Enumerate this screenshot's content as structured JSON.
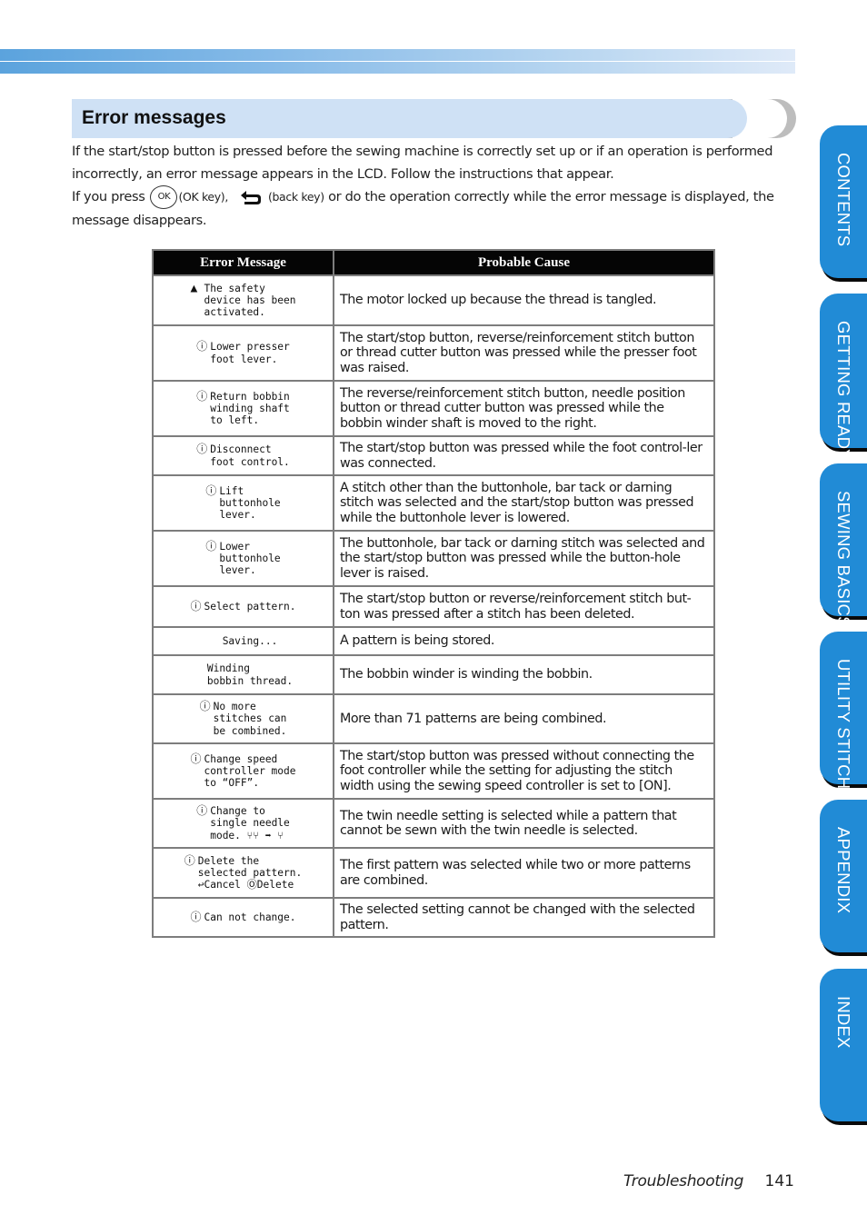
{
  "section": {
    "title": "Error messages"
  },
  "intro": {
    "line1": "If the start/stop button is pressed before the sewing machine is correctly set up or if an operation is performed incorrectly, an error message appears in the LCD. Follow the instructions that appear.",
    "line2_prefix": "If you press",
    "ok_key_glyph": "OK",
    "ok_key_label": "(OK key),",
    "back_key_label": "(back key)",
    "line2_suffix": "or do the operation correctly while the error message is displayed, the message disappears."
  },
  "table": {
    "headers": [
      "Error Message",
      "Probable Cause"
    ],
    "rows": [
      {
        "icon": "warning-icon",
        "glyph": "▲",
        "message": "The safety\ndevice has been\nactivated.",
        "cause": "The motor locked up because the thread is tangled."
      },
      {
        "icon": "alert-circle-icon",
        "glyph": "ⓘ",
        "message": "Lower presser\nfoot lever.",
        "cause": "The start/stop button, reverse/reinforcement stitch button or thread cutter button was pressed while the presser foot was raised."
      },
      {
        "icon": "alert-circle-icon",
        "glyph": "ⓘ",
        "message": "Return bobbin\nwinding shaft\nto left.",
        "cause": "The reverse/reinforcement stitch button, needle position button or thread cutter button was pressed while the bobbin winder shaft is moved to the right."
      },
      {
        "icon": "alert-circle-icon",
        "glyph": "ⓘ",
        "message": "Disconnect\nfoot control.",
        "cause": "The start/stop button was pressed while the foot control-ler was connected."
      },
      {
        "icon": "alert-circle-icon",
        "glyph": "ⓘ",
        "message": "Lift\nbuttonhole\nlever.",
        "cause": "A stitch other than the buttonhole, bar tack or darning stitch was selected and the start/stop button was pressed while the buttonhole lever is lowered."
      },
      {
        "icon": "alert-circle-icon",
        "glyph": "ⓘ",
        "message": "Lower\nbuttonhole\nlever.",
        "cause": "The buttonhole, bar tack or darning stitch was selected and the start/stop button was pressed while the button-hole lever is raised."
      },
      {
        "icon": "alert-circle-icon",
        "glyph": "ⓘ",
        "message": "Select pattern.",
        "cause": "The start/stop button or reverse/reinforcement stitch but-ton was pressed after a stitch has been deleted."
      },
      {
        "icon": "",
        "glyph": "",
        "message": "Saving...",
        "cause": "A pattern is being stored."
      },
      {
        "icon": "",
        "glyph": "",
        "message": "Winding\nbobbin thread.",
        "cause": "The bobbin winder is winding the bobbin."
      },
      {
        "icon": "alert-circle-icon",
        "glyph": "ⓘ",
        "message": "No more\nstitches can\nbe combined.",
        "cause": "More than 71 patterns are being combined."
      },
      {
        "icon": "alert-circle-icon",
        "glyph": "ⓘ",
        "message": "Change speed\ncontroller mode\nto “OFF”.",
        "cause": "The start/stop button was pressed without connecting the foot controller while the setting for adjusting the stitch width using the sewing speed controller is set to [ON]."
      },
      {
        "icon": "alert-circle-icon",
        "glyph": "ⓘ",
        "message": "Change to\nsingle needle\nmode. ⑂⑂ ➡ ⑂",
        "cause": "The twin needle setting is selected while a pattern that cannot be sewn with the twin needle is selected."
      },
      {
        "icon": "alert-circle-icon",
        "glyph": "ⓘ",
        "message": "Delete the\nselected pattern.\n↩Cancel ⓄDelete",
        "cause": "The first pattern was selected while two or more patterns are combined."
      },
      {
        "icon": "alert-circle-icon",
        "glyph": "ⓘ",
        "message": "Can not change.",
        "cause": "The selected setting cannot be changed with the selected pattern."
      }
    ]
  },
  "side_tabs": [
    {
      "label": "CONTENTS"
    },
    {
      "label": "GETTING READY"
    },
    {
      "label": "SEWING BASICS"
    },
    {
      "label": "UTILITY STITCHES"
    },
    {
      "label": "APPENDIX"
    },
    {
      "label": "INDEX"
    }
  ],
  "footer": {
    "section": "Troubleshooting",
    "page": "141"
  },
  "colors": {
    "tab_blue": "#218bd6",
    "heading_band": "#cfe1f5",
    "table_header": "#050505",
    "table_border": "#7d7d7d"
  }
}
